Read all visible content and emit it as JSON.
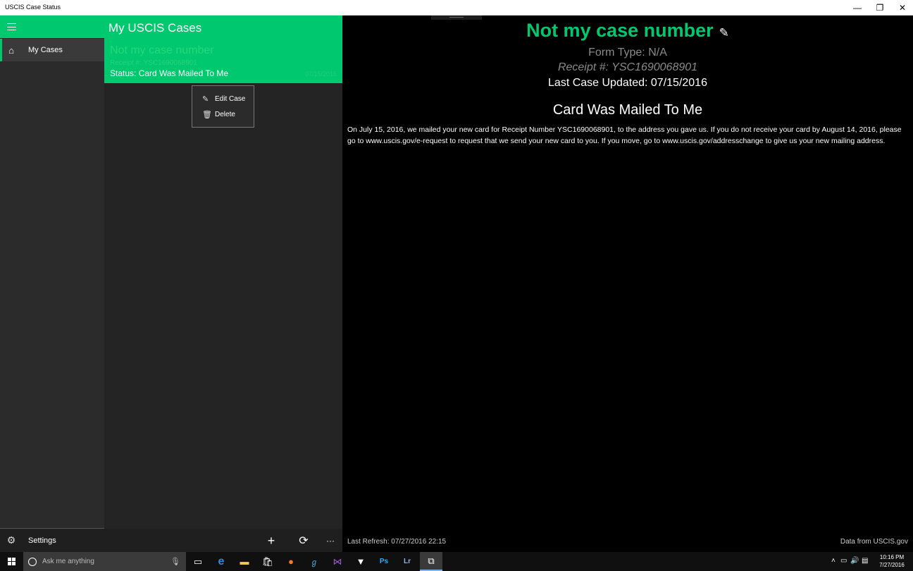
{
  "window": {
    "title": "USCIS Case Status",
    "minimize_icon": "minimize-icon",
    "maximize_icon": "restore-icon",
    "close_icon": "close-icon"
  },
  "nav": {
    "items": [
      {
        "label": "My Cases",
        "icon": "home-icon",
        "active": true
      }
    ],
    "settings_label": "Settings"
  },
  "list": {
    "header": "My USCIS Cases",
    "cases": [
      {
        "name": "Not my case number",
        "receipt": "Receipt #: YSC1690068901",
        "status": "Status: Card Was Mailed To Me",
        "date": "07/15/2016"
      }
    ],
    "context_menu": [
      {
        "label": "Edit Case",
        "icon": "pencil-icon"
      },
      {
        "label": "Delete",
        "icon": "trash-icon"
      }
    ],
    "commands": {
      "add": "add-icon",
      "refresh": "refresh-icon",
      "more": "more-icon"
    }
  },
  "detail": {
    "title": "Not my case number",
    "form_type": "Form Type: N/A",
    "receipt": "Receipt #: YSC1690068901",
    "last_updated": "Last Case Updated: 07/15/2016",
    "status_title": "Card Was Mailed To Me",
    "status_text": "On July 15, 2016, we mailed your new card for Receipt Number YSC1690068901, to the address you gave us. If you do not receive your card by August 14, 2016, please go to www.uscis.gov/e-request to request that we send your new card to you. If you move, go to www.uscis.gov/addresschange to give us your new mailing address.",
    "last_refresh": "Last Refresh:  07/27/2016 22:15",
    "source": "Data from USCIS.gov"
  },
  "taskbar": {
    "search_placeholder": "Ask me anything",
    "clock_time": "10:16 PM",
    "clock_date": "7/27/2016"
  },
  "colors": {
    "accent": "#00c86e",
    "nav_bg": "#2b2b2b",
    "list_bg": "#242424",
    "detail_bg": "#000000"
  }
}
